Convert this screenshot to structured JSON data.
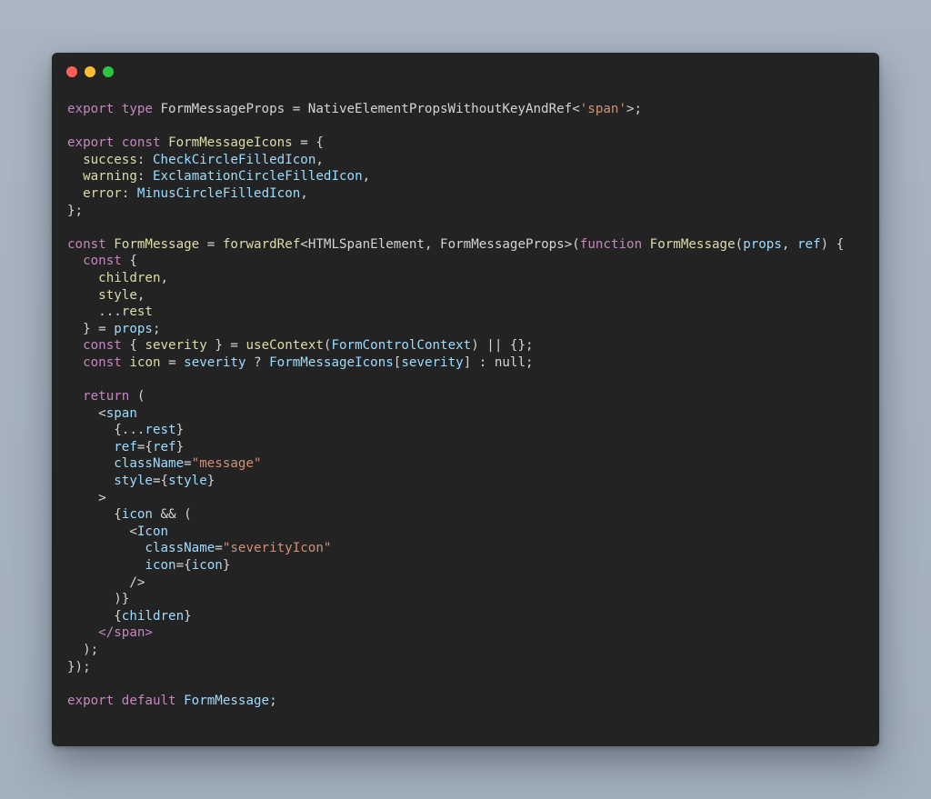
{
  "window": {
    "controls": [
      "close",
      "minimize",
      "zoom"
    ]
  },
  "code": {
    "lines": [
      [
        [
          "kw",
          "export"
        ],
        [
          "plain",
          " "
        ],
        [
          "kw",
          "type"
        ],
        [
          "plain",
          " FormMessageProps = NativeElementPropsWithoutKeyAndRef<"
        ],
        [
          "str",
          "'span'"
        ],
        [
          "plain",
          ">;"
        ]
      ],
      [],
      [
        [
          "kw",
          "export"
        ],
        [
          "plain",
          " "
        ],
        [
          "kw",
          "const"
        ],
        [
          "plain",
          " "
        ],
        [
          "ty",
          "FormMessageIcons"
        ],
        [
          "plain",
          " = {"
        ]
      ],
      [
        [
          "plain",
          "  "
        ],
        [
          "prop",
          "success"
        ],
        [
          "plain",
          ": "
        ],
        [
          "var",
          "CheckCircleFilledIcon"
        ],
        [
          "plain",
          ","
        ]
      ],
      [
        [
          "plain",
          "  "
        ],
        [
          "prop",
          "warning"
        ],
        [
          "plain",
          ": "
        ],
        [
          "var",
          "ExclamationCircleFilledIcon"
        ],
        [
          "plain",
          ","
        ]
      ],
      [
        [
          "plain",
          "  "
        ],
        [
          "prop",
          "error"
        ],
        [
          "plain",
          ": "
        ],
        [
          "var",
          "MinusCircleFilledIcon"
        ],
        [
          "plain",
          ","
        ]
      ],
      [
        [
          "plain",
          "};"
        ]
      ],
      [],
      [
        [
          "kw",
          "const"
        ],
        [
          "plain",
          " "
        ],
        [
          "ty",
          "FormMessage"
        ],
        [
          "plain",
          " = "
        ],
        [
          "fn",
          "forwardRef"
        ],
        [
          "plain",
          "<HTMLSpanElement, FormMessageProps>("
        ],
        [
          "kw",
          "function"
        ],
        [
          "plain",
          " "
        ],
        [
          "fn",
          "FormMessage"
        ],
        [
          "plain",
          "("
        ],
        [
          "var",
          "props"
        ],
        [
          "plain",
          ", "
        ],
        [
          "var",
          "ref"
        ],
        [
          "plain",
          ") {"
        ]
      ],
      [
        [
          "plain",
          "  "
        ],
        [
          "kw",
          "const"
        ],
        [
          "plain",
          " {"
        ]
      ],
      [
        [
          "plain",
          "    "
        ],
        [
          "ty",
          "children"
        ],
        [
          "plain",
          ","
        ]
      ],
      [
        [
          "plain",
          "    "
        ],
        [
          "ty",
          "style"
        ],
        [
          "plain",
          ","
        ]
      ],
      [
        [
          "plain",
          "    ..."
        ],
        [
          "ty",
          "rest"
        ]
      ],
      [
        [
          "plain",
          "  } = "
        ],
        [
          "var",
          "props"
        ],
        [
          "plain",
          ";"
        ]
      ],
      [
        [
          "plain",
          "  "
        ],
        [
          "kw",
          "const"
        ],
        [
          "plain",
          " { "
        ],
        [
          "ty",
          "severity"
        ],
        [
          "plain",
          " } = "
        ],
        [
          "fn",
          "useContext"
        ],
        [
          "plain",
          "("
        ],
        [
          "var",
          "FormControlContext"
        ],
        [
          "plain",
          ") || {};"
        ]
      ],
      [
        [
          "plain",
          "  "
        ],
        [
          "kw",
          "const"
        ],
        [
          "plain",
          " "
        ],
        [
          "ty",
          "icon"
        ],
        [
          "plain",
          " = "
        ],
        [
          "var",
          "severity"
        ],
        [
          "plain",
          " ? "
        ],
        [
          "var",
          "FormMessageIcons"
        ],
        [
          "plain",
          "["
        ],
        [
          "var",
          "severity"
        ],
        [
          "plain",
          "] : null;"
        ]
      ],
      [],
      [
        [
          "plain",
          "  "
        ],
        [
          "kw",
          "return"
        ],
        [
          "plain",
          " ("
        ]
      ],
      [
        [
          "plain",
          "    <"
        ],
        [
          "cmp",
          "span"
        ]
      ],
      [
        [
          "plain",
          "      {..."
        ],
        [
          "var",
          "rest"
        ],
        [
          "plain",
          "}"
        ]
      ],
      [
        [
          "plain",
          "      "
        ],
        [
          "var",
          "ref"
        ],
        [
          "plain",
          "={"
        ],
        [
          "var",
          "ref"
        ],
        [
          "plain",
          "}"
        ]
      ],
      [
        [
          "plain",
          "      "
        ],
        [
          "var",
          "className"
        ],
        [
          "plain",
          "="
        ],
        [
          "str",
          "\"message\""
        ]
      ],
      [
        [
          "plain",
          "      "
        ],
        [
          "var",
          "style"
        ],
        [
          "plain",
          "={"
        ],
        [
          "var",
          "style"
        ],
        [
          "plain",
          "}"
        ]
      ],
      [
        [
          "plain",
          "    >"
        ]
      ],
      [
        [
          "plain",
          "      {"
        ],
        [
          "var",
          "icon"
        ],
        [
          "plain",
          " && ("
        ]
      ],
      [
        [
          "plain",
          "        <"
        ],
        [
          "cmp",
          "Icon"
        ]
      ],
      [
        [
          "plain",
          "          "
        ],
        [
          "var",
          "className"
        ],
        [
          "plain",
          "="
        ],
        [
          "str",
          "\"severityIcon\""
        ]
      ],
      [
        [
          "plain",
          "          "
        ],
        [
          "var",
          "icon"
        ],
        [
          "plain",
          "={"
        ],
        [
          "var",
          "icon"
        ],
        [
          "plain",
          "}"
        ]
      ],
      [
        [
          "plain",
          "        />"
        ]
      ],
      [
        [
          "plain",
          "      )}"
        ]
      ],
      [
        [
          "plain",
          "      {"
        ],
        [
          "var",
          "children"
        ],
        [
          "plain",
          "}"
        ]
      ],
      [
        [
          "plain",
          "    "
        ],
        [
          "tag",
          "</span>"
        ]
      ],
      [
        [
          "plain",
          "  );"
        ]
      ],
      [
        [
          "plain",
          "});"
        ]
      ],
      [],
      [
        [
          "kw",
          "export"
        ],
        [
          "plain",
          " "
        ],
        [
          "kw",
          "default"
        ],
        [
          "plain",
          " "
        ],
        [
          "var",
          "FormMessage"
        ],
        [
          "plain",
          ";"
        ]
      ]
    ]
  }
}
